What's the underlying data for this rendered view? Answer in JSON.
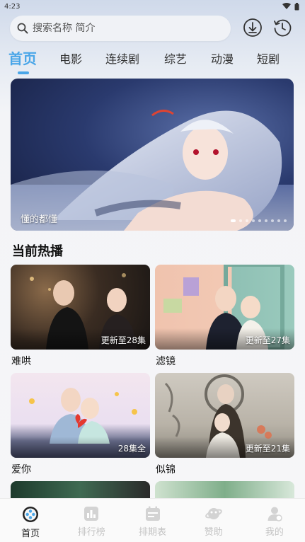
{
  "status_bar": {
    "time": "4:23"
  },
  "search": {
    "placeholder": "搜索名称 简介"
  },
  "tabs": [
    {
      "label": "首页",
      "active": true
    },
    {
      "label": "电影",
      "active": false
    },
    {
      "label": "连续剧",
      "active": false
    },
    {
      "label": "综艺",
      "active": false
    },
    {
      "label": "动漫",
      "active": false
    },
    {
      "label": "短剧",
      "active": false
    }
  ],
  "banner": {
    "caption": "懂的都懂",
    "slide_count": 9,
    "active_index": 0
  },
  "section": {
    "title": "当前热播"
  },
  "cards": [
    {
      "title": "难哄",
      "badge": "更新至28集"
    },
    {
      "title": "滤镜",
      "badge": "更新至27集"
    },
    {
      "title": "爱你",
      "badge": "28集全"
    },
    {
      "title": "似锦",
      "badge": "更新至21集"
    }
  ],
  "bottom_nav": [
    {
      "label": "首页",
      "icon": "home-film-reel-icon",
      "active": true
    },
    {
      "label": "排行榜",
      "icon": "bar-chart-icon",
      "active": false
    },
    {
      "label": "排期表",
      "icon": "calendar-icon",
      "active": false
    },
    {
      "label": "赞助",
      "icon": "planet-icon",
      "active": false
    },
    {
      "label": "我的",
      "icon": "user-icon",
      "active": false
    }
  ],
  "colors": {
    "accent": "#4aa6e8",
    "inactive_nav": "#c4c4c4"
  }
}
